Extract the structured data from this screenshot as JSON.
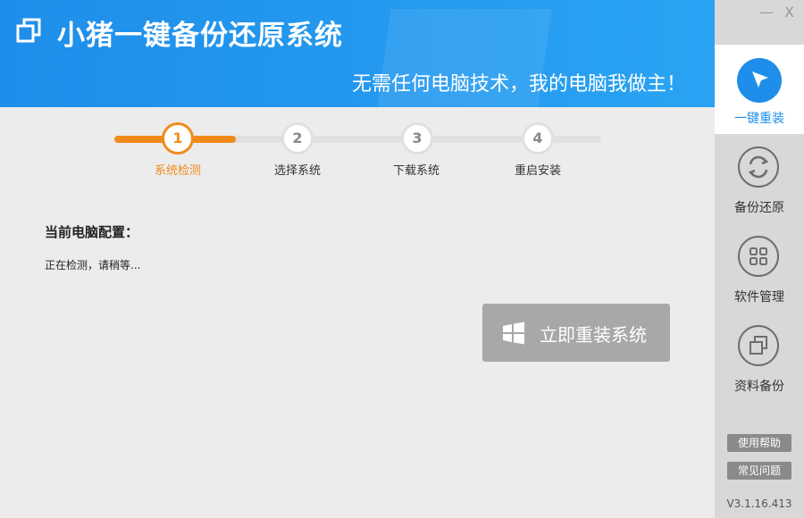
{
  "app": {
    "title": "小猪一键备份还原系统",
    "slogan": "无需任何电脑技术，我的电脑我做主！"
  },
  "window": {
    "minimize": "—",
    "close": "X"
  },
  "steps": [
    {
      "num": "1",
      "label": "系统检测",
      "state": "current"
    },
    {
      "num": "2",
      "label": "选择系统",
      "state": "pending"
    },
    {
      "num": "3",
      "label": "下载系统",
      "state": "pending"
    },
    {
      "num": "4",
      "label": "重启安装",
      "state": "pending"
    }
  ],
  "main": {
    "config_title": "当前电脑配置：",
    "status": "正在检测，请稍等...",
    "reinstall_label": "立即重装系统"
  },
  "sidebar": {
    "items": [
      {
        "label": "一键重装",
        "icon": "cursor-arrow-icon",
        "active": true
      },
      {
        "label": "备份还原",
        "icon": "refresh-icon",
        "active": false
      },
      {
        "label": "软件管理",
        "icon": "grid-icon",
        "active": false
      },
      {
        "label": "资料备份",
        "icon": "copy-icon",
        "active": false
      }
    ],
    "help_label": "使用帮助",
    "faq_label": "常见问题",
    "version": "V3.1.16.413"
  },
  "colors": {
    "accent": "#1e8eea",
    "step_active": "#f08b1a",
    "button_disabled": "#a8a8a8",
    "sidebar_bg": "#d8d8d8"
  }
}
